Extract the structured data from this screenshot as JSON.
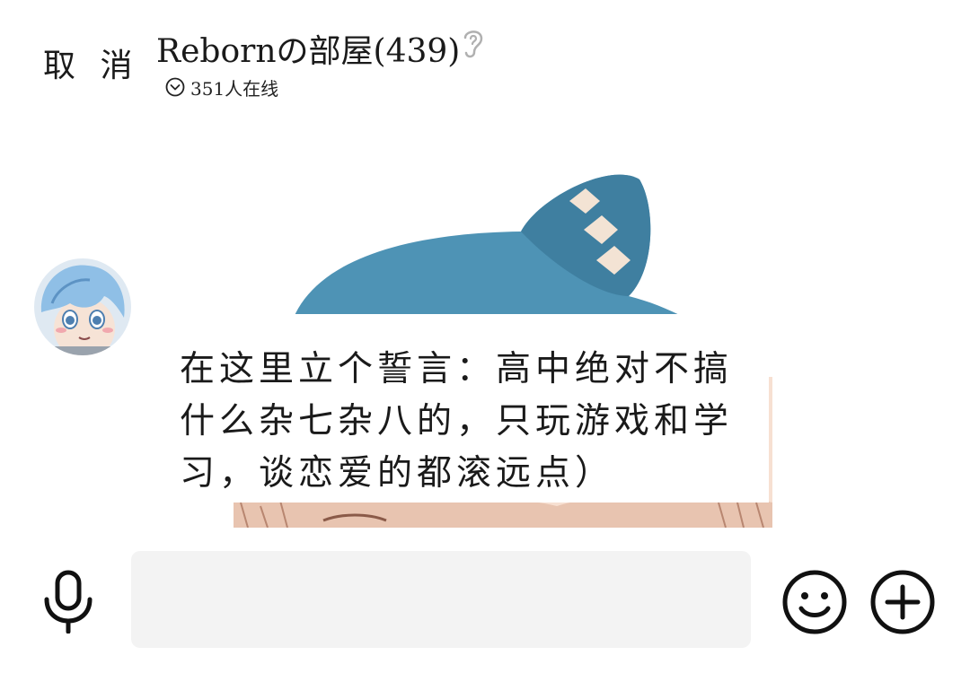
{
  "header": {
    "cancel_label": "取 消",
    "room_title": "Rebornの部屋(439)",
    "online_count": "351人在线"
  },
  "message": {
    "caption_lines": [
      "在这里立个誓言：高中绝对不搞",
      "什么杂七杂八的，只玩游戏和学",
      "习，谈恋爱的都滚远点）"
    ]
  },
  "input_bar": {
    "text_value": "",
    "placeholder": ""
  },
  "icons": {
    "room_mode": "ear-icon",
    "online_toggle": "chevron-down-circle-icon",
    "voice": "microphone-icon",
    "emoji": "smiley-icon",
    "more": "plus-circle-icon"
  },
  "colors": {
    "hat_blue": "#4e93b5",
    "hair_blue": "#8fbfe6",
    "skin": "#f7e0d2",
    "input_bg": "#f3f3f3"
  }
}
